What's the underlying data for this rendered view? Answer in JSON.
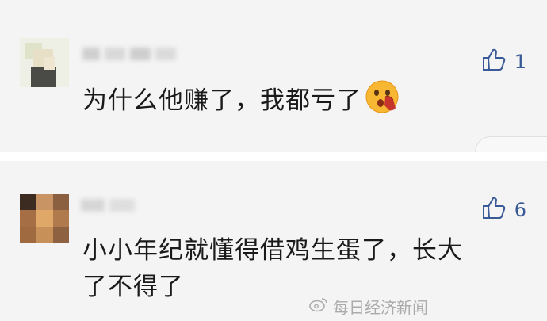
{
  "comments": [
    {
      "text": "为什么他赚了，我都亏了",
      "likes": "1",
      "emoji": "face-with-hand-over-mouth"
    },
    {
      "text_line1": "小小年纪就懂得借鸡生蛋了，长大",
      "text_line2": "了不得了",
      "likes": "6"
    }
  ],
  "watermark": "每日经济新闻",
  "colors": {
    "like": "#3a5a97",
    "background": "#f4f4f4"
  }
}
